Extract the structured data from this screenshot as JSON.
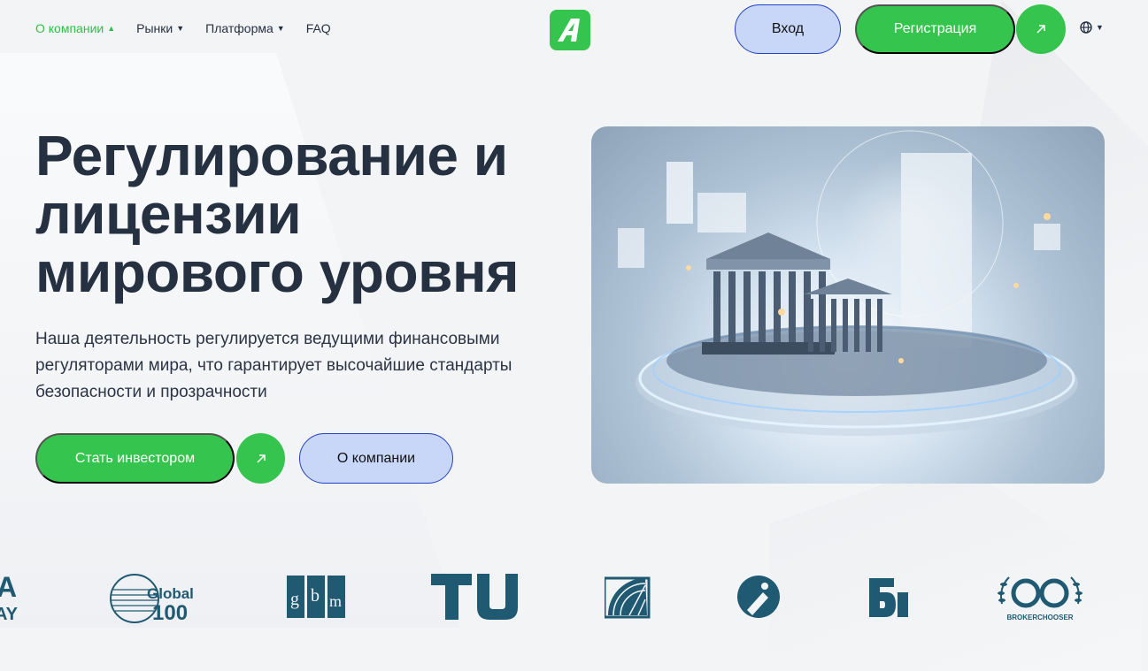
{
  "nav": {
    "items": [
      {
        "label": "О компании",
        "active": true,
        "chevron": "up"
      },
      {
        "label": "Рынки",
        "active": false,
        "chevron": "down"
      },
      {
        "label": "Платформа",
        "active": false,
        "chevron": "down"
      },
      {
        "label": "FAQ",
        "active": false,
        "chevron": ""
      }
    ]
  },
  "header": {
    "login_label": "Вход",
    "register_label": "Регистрация",
    "logo_icon": "brand-a-logo",
    "lang_icon": "globe-icon"
  },
  "hero": {
    "title": "Регулирование и лицензии мирового уровня",
    "subtitle": "Наша деятельность регулируется ведущими финансовыми регуляторами мира, что гарантирует высочайшие стандарты безопасности и прозрачности",
    "cta_primary": "Стать инвестором",
    "cta_secondary": "О компании",
    "image_icon": "bank-building-illustration"
  },
  "partners": {
    "logos": [
      {
        "name": "partial-a-logo",
        "text": "A\nAY"
      },
      {
        "name": "global-100-logo",
        "text": "Global 100"
      },
      {
        "name": "gbm-logo",
        "text": "gbm"
      },
      {
        "name": "tu-logo",
        "text": "TU"
      },
      {
        "name": "globe-grid-logo",
        "text": ""
      },
      {
        "name": "i-circle-logo",
        "text": ""
      },
      {
        "name": "bt-logo",
        "text": ""
      },
      {
        "name": "brokerchooser-logo",
        "text": "BROKERCHOOSER"
      }
    ]
  },
  "colors": {
    "accent_green": "#35c44d",
    "accent_blue_bg": "#c8d6f7",
    "accent_blue_border": "#2340c4",
    "text_dark": "#253041",
    "logo_teal": "#1f5a72"
  }
}
